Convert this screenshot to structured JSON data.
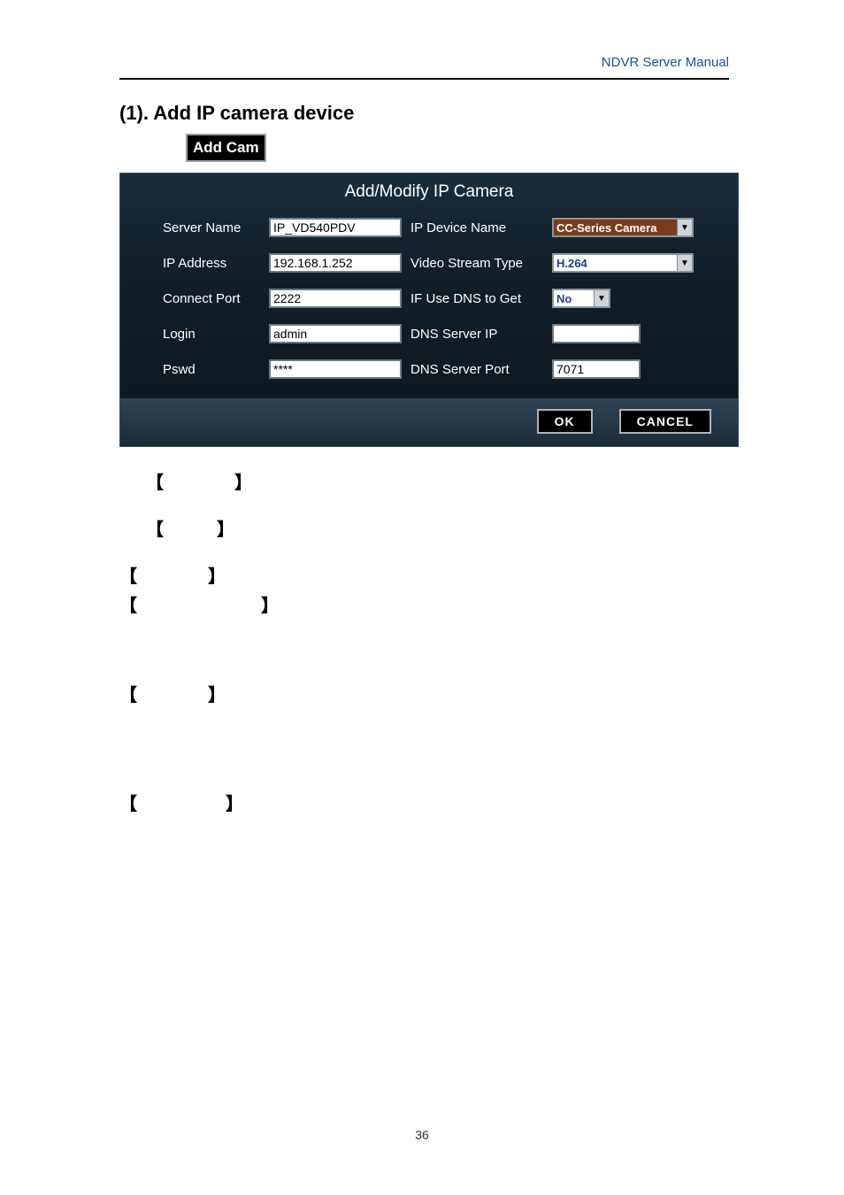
{
  "header": {
    "link_text": "NDVR Server Manual"
  },
  "section_title": "(1). Add IP camera device",
  "add_cam_label": "Add Cam",
  "dialog": {
    "title": "Add/Modify IP Camera",
    "left_fields": {
      "server_name": {
        "label": "Server Name",
        "value": "IP_VD540PDV"
      },
      "ip_address": {
        "label": "IP Address",
        "value": "192.168.1.252"
      },
      "connect_port": {
        "label": "Connect Port",
        "value": "2222"
      },
      "login": {
        "label": "Login",
        "value": "admin"
      },
      "pswd": {
        "label": "Pswd",
        "value": "****"
      }
    },
    "right_fields": {
      "ip_device_name": {
        "label": "IP Device Name",
        "value": "CC-Series Camera"
      },
      "video_stream_type": {
        "label": "Video Stream Type",
        "value": "H.264"
      },
      "use_dns": {
        "label": "IF Use DNS to Get",
        "value": "No"
      },
      "dns_server_ip": {
        "label": "DNS Server IP",
        "value": ""
      },
      "dns_server_port": {
        "label": "DNS Server Port",
        "value": "7071"
      }
    },
    "buttons": {
      "ok": "OK",
      "cancel": "CANCEL"
    }
  },
  "page_number": "36"
}
